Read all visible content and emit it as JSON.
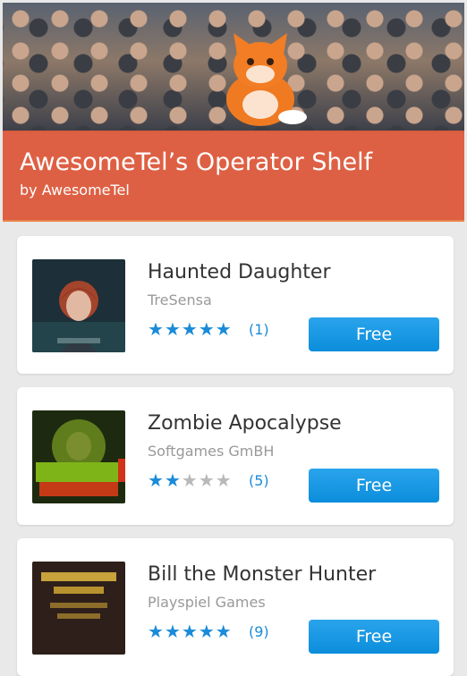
{
  "header": {
    "title": "AwesomeTel’s Operator Shelf",
    "subtitle": "by AwesomeTel"
  },
  "apps": [
    {
      "name": "Haunted Daughter",
      "developer": "TreSensa",
      "rating": 5,
      "reviews_label": "(1)",
      "button_label": "Free"
    },
    {
      "name": "Zombie Apocalypse",
      "developer": "Softgames GmBH",
      "rating": 2,
      "reviews_label": "(5)",
      "button_label": "Free"
    },
    {
      "name": "Bill the Monster Hunter",
      "developer": "Playspiel Games",
      "rating": 5,
      "reviews_label": "(9)",
      "button_label": "Free"
    }
  ]
}
